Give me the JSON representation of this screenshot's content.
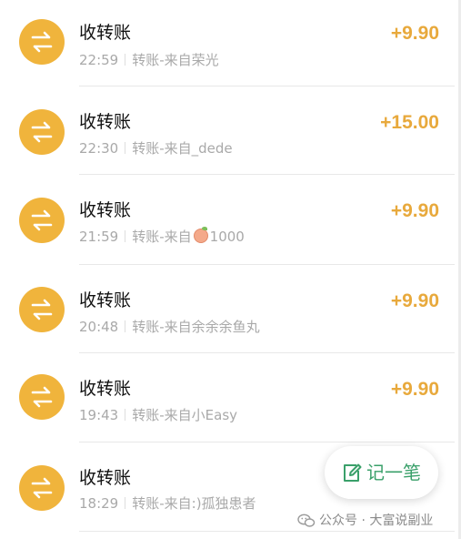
{
  "transactions": [
    {
      "title": "收转账",
      "time": "22:59",
      "desc": "转账-来自荣光",
      "amount": "+9.90"
    },
    {
      "title": "收转账",
      "time": "22:30",
      "desc": "转账-来自_dede",
      "amount": "+15.00"
    },
    {
      "title": "收转账",
      "time": "21:59",
      "desc_prefix": "转账-来自",
      "desc_suffix": "1000",
      "amount": "+9.90"
    },
    {
      "title": "收转账",
      "time": "20:48",
      "desc": "转账-来自余余余鱼丸",
      "amount": "+9.90"
    },
    {
      "title": "收转账",
      "time": "19:43",
      "desc": "转账-来自小Easy",
      "amount": "+9.90"
    },
    {
      "title": "收转账",
      "time": "18:29",
      "desc": "转账-来自:)孤独患者",
      "amount": ""
    }
  ],
  "fab": {
    "label": "记一笔",
    "icon": "edit-note-icon"
  },
  "watermark": {
    "text": "公众号 · 大富说副业",
    "icon": "wechat-icon"
  },
  "icons": {
    "transaction": "transfer-arrows-icon"
  },
  "colors": {
    "icon_bg": "#f0b43c",
    "amount": "#e8a93c",
    "fab_text": "#3aa06a",
    "meta_text": "#a9a9a9"
  }
}
